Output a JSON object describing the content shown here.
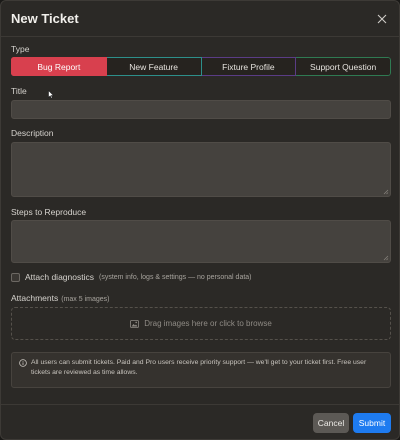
{
  "dialog": {
    "title": "New Ticket"
  },
  "type": {
    "label": "Type",
    "options": [
      "Bug Report",
      "New Feature",
      "Fixture Profile",
      "Support Question"
    ],
    "selected": "Bug Report"
  },
  "title_field": {
    "label": "Title",
    "value": ""
  },
  "description_field": {
    "label": "Description",
    "value": ""
  },
  "steps_field": {
    "label": "Steps to Reproduce",
    "value": ""
  },
  "diagnostics": {
    "label": "Attach diagnostics",
    "hint": "(system info, logs & settings — no personal data)",
    "checked": false
  },
  "attachments": {
    "label": "Attachments",
    "hint": "(max 5 images)",
    "drop_text": "Drag images here or click to browse"
  },
  "info": {
    "icon": "info-circle-icon",
    "text": "All users can submit tickets. Paid and Pro users receive priority support — we'll get to your ticket first. Free user tickets are reviewed as time allows."
  },
  "footer": {
    "cancel_label": "Cancel",
    "submit_label": "Submit"
  },
  "colors": {
    "bug": "#d8404e",
    "feature": "#2d8f8a",
    "fixture": "#5a3c85",
    "support": "#2f7a52",
    "submit": "#1e7bf0"
  }
}
